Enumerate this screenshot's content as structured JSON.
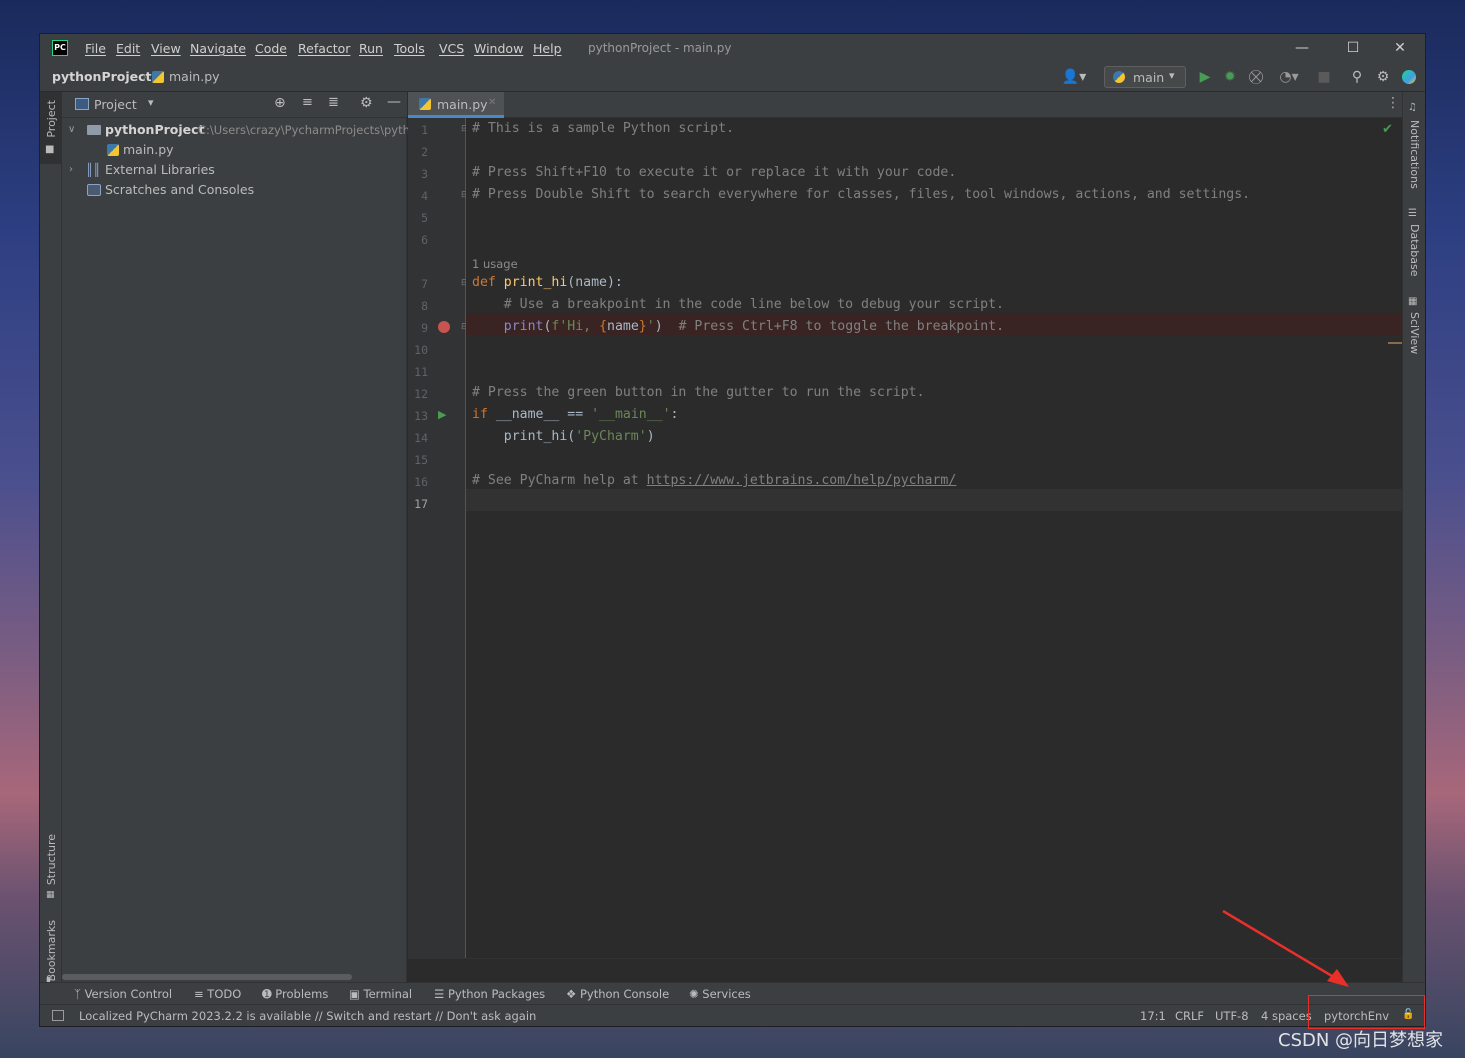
{
  "window": {
    "title": "pythonProject - main.py",
    "logo_text": "PC",
    "menu": [
      "File",
      "Edit",
      "View",
      "Navigate",
      "Code",
      "Refactor",
      "Run",
      "Tools",
      "VCS",
      "Window",
      "Help"
    ]
  },
  "navbar": {
    "breadcrumb_project": "pythonProject",
    "breadcrumb_file": "main.py",
    "run_config": "main"
  },
  "left_strip": {
    "project": "Project",
    "structure": "Structure",
    "bookmarks": "Bookmarks"
  },
  "right_strip": {
    "notifications": "Notifications",
    "database": "Database",
    "sciview": "SciView"
  },
  "project_panel": {
    "title": "Project",
    "tree": [
      {
        "label": "pythonProject",
        "path": "C:\\Users\\crazy\\PycharmProjects\\pyth"
      },
      {
        "label": "main.py"
      },
      {
        "label": "External Libraries"
      },
      {
        "label": "Scratches and Consoles"
      }
    ]
  },
  "editor": {
    "tab_label": "main.py",
    "inlay_usage": "1 usage",
    "line_numbers": [
      "1",
      "2",
      "3",
      "4",
      "5",
      "6",
      "7",
      "8",
      "9",
      "10",
      "11",
      "12",
      "13",
      "14",
      "15",
      "16",
      "17"
    ],
    "code": {
      "l1": "# This is a sample Python script.",
      "l3": "# Press Shift+F10 to execute it or replace it with your code.",
      "l4": "# Press Double Shift to search everywhere for classes, files, tool windows, actions, and settings.",
      "l7_kw": "def ",
      "l7_fn": "print_hi",
      "l7_rest": "(name):",
      "l8": "    # Use a breakpoint in the code line below to debug your script.",
      "l9_indent": "    ",
      "l9_print": "print",
      "l9_open": "(",
      "l9_str1": "f'Hi, ",
      "l9_brace1": "{",
      "l9_name": "name",
      "l9_brace2": "}",
      "l9_str2": "'",
      "l9_close": ")",
      "l9_comment": "  # Press Ctrl+F8 to toggle the breakpoint.",
      "l12": "# Press the green button in the gutter to run the script.",
      "l13_kw": "if ",
      "l13_name": "__name__",
      "l13_eq": " == ",
      "l13_str": "'__main__'",
      "l13_colon": ":",
      "l14_call": "    print_hi(",
      "l14_str": "'PyCharm'",
      "l14_close": ")",
      "l16_comment": "# See PyCharm help at ",
      "l16_url": "https://www.jetbrains.com/help/pycharm/"
    }
  },
  "tool_windows": [
    "Version Control",
    "TODO",
    "Problems",
    "Terminal",
    "Python Packages",
    "Python Console",
    "Services"
  ],
  "status": {
    "message": "Localized PyCharm 2023.2.2 is available // Switch and restart // Don't ask again",
    "position": "17:1",
    "line_sep": "CRLF",
    "encoding": "UTF-8",
    "indent": "4 spaces",
    "interpreter": "pytorchEnv"
  },
  "watermark": "CSDN @向日梦想家",
  "colors": {
    "accent": "#4a88c7",
    "annotation": "#e8302a",
    "run_green": "#499c54",
    "breakpoint": "#c75450"
  }
}
